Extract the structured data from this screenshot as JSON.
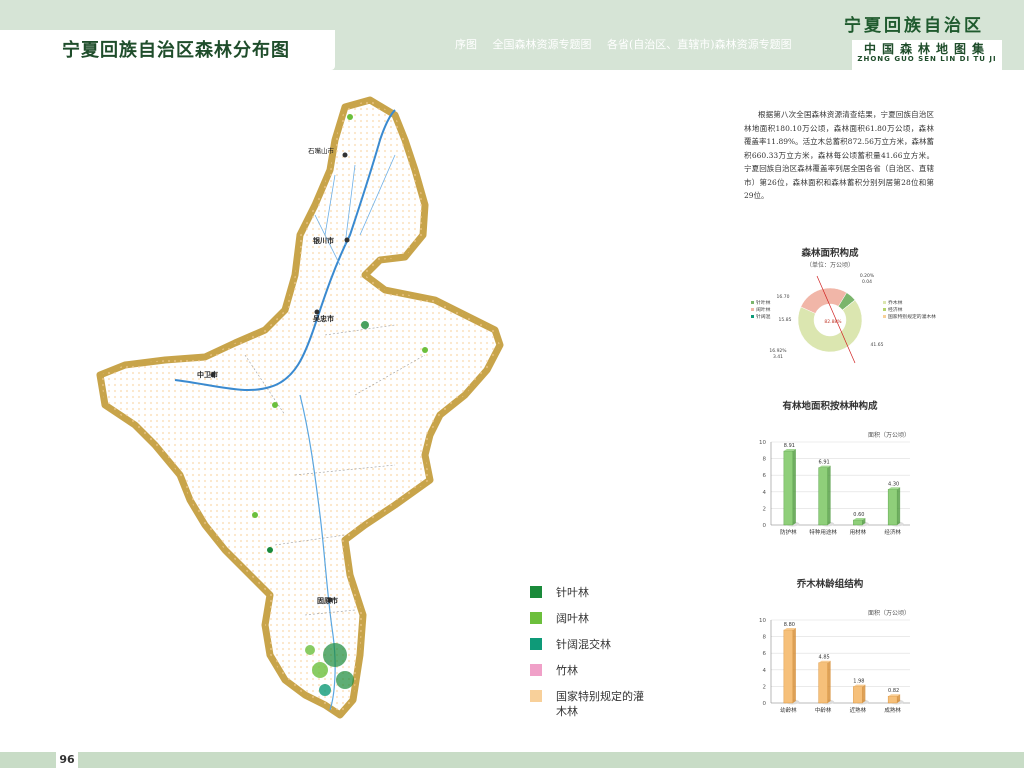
{
  "header": {
    "page_title": "宁夏回族自治区森林分布图",
    "nav_items": [
      "序图",
      "全国森林资源专题图",
      "各省(自治区、直辖市)森林资源专题图"
    ],
    "region_name": "宁夏回族自治区",
    "atlas_title": "中国森林地图集",
    "atlas_pinyin": "ZHONG GUO SEN LIN DI TU JI"
  },
  "page_number": "96",
  "intro_text": "根据第八次全国森林资源清查结果，宁夏回族自治区林地面积180.10万公顷，森林面积61.80万公顷，森林覆盖率11.89%。活立木总蓄积872.56万立方米，森林蓄积660.33万立方米，森林每公顷蓄积量41.66立方米。宁夏回族自治区森林覆盖率列居全国各省（自治区、直辖市）第26位，森林面积和森林蓄积分别列居第28位和第29位。",
  "map_labels": [
    "石嘴山市",
    "银川市",
    "吴忠市",
    "中卫市",
    "固原市"
  ],
  "legend": [
    {
      "label": "针叶林",
      "color": "#1a8a3a"
    },
    {
      "label": "阔叶林",
      "color": "#6cbf3c"
    },
    {
      "label": "针阔混交林",
      "color": "#0e9a78"
    },
    {
      "label": "竹林",
      "color": "#f0a0c8"
    },
    {
      "label": "国家特别规定的灌木林",
      "color": "#f8d09a"
    }
  ],
  "charts": {
    "pie_title": "森林面积构成",
    "pie_unit": "（单位：万公顷）",
    "pie_legend": [
      "针叶林",
      "阔叶林",
      "针阔混",
      "乔木林",
      "经济林",
      "国家特别规定的灌木林"
    ],
    "bar1_title": "有林地面积按林种构成",
    "bar1_unit": "面积（万公顷）",
    "bar2_title": "乔木林龄组结构",
    "bar2_unit": "面积（万公顷）"
  },
  "chart_data": [
    {
      "type": "pie",
      "title": "森林面积构成",
      "unit": "万公顷",
      "slices": [
        {
          "name": "国家特别规定的灌木林",
          "value": 41.65
        },
        {
          "name": "乔木林",
          "value": 16.7
        },
        {
          "name": "经济林",
          "value": 3.41
        },
        {
          "name": "针阔混",
          "value": 0.04
        }
      ],
      "annotations": [
        "0.20%",
        "0.04",
        "16.70",
        "15.85",
        "82.88%",
        "16.92%",
        "3.41",
        "41.65"
      ]
    },
    {
      "type": "bar",
      "title": "有林地面积按林种构成",
      "ylabel": "面积（万公顷）",
      "categories": [
        "防护林",
        "特种用途林",
        "用材林",
        "经济林"
      ],
      "values": [
        8.91,
        6.91,
        0.6,
        4.3
      ],
      "ylim": [
        0,
        10
      ],
      "yticks": [
        0,
        2,
        4,
        6,
        8,
        10
      ]
    },
    {
      "type": "bar",
      "title": "乔木林龄组结构",
      "ylabel": "面积（万公顷）",
      "categories": [
        "幼龄林",
        "中龄林",
        "近熟林",
        "成熟林"
      ],
      "values": [
        8.8,
        4.85,
        1.98,
        0.82
      ],
      "ylim": [
        0,
        10
      ],
      "yticks": [
        0,
        2,
        4,
        6,
        8,
        10
      ]
    }
  ]
}
